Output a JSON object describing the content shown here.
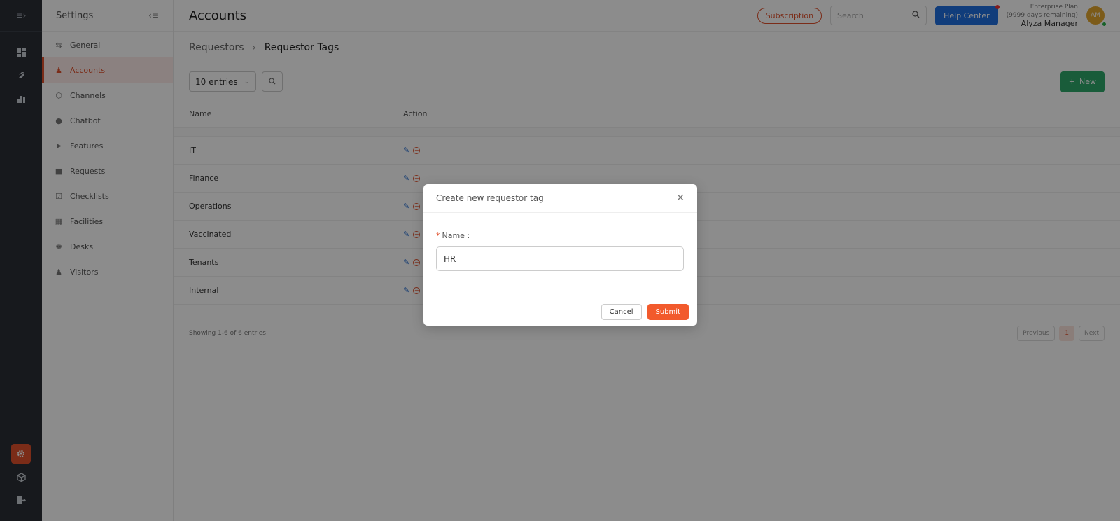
{
  "rail": {
    "icons": [
      "menu-expand-icon",
      "dashboard-icon",
      "rocket-icon",
      "analytics-icon",
      "gear-icon",
      "cube-icon",
      "logout-icon"
    ]
  },
  "sidebar": {
    "title": "Settings",
    "items": [
      {
        "label": "General",
        "icon": "sliders-icon"
      },
      {
        "label": "Accounts",
        "icon": "users-icon",
        "active": true
      },
      {
        "label": "Channels",
        "icon": "cube-icon"
      },
      {
        "label": "Chatbot",
        "icon": "chat-icon"
      },
      {
        "label": "Features",
        "icon": "rocket-icon"
      },
      {
        "label": "Requests",
        "icon": "question-icon"
      },
      {
        "label": "Checklists",
        "icon": "checklist-icon"
      },
      {
        "label": "Facilities",
        "icon": "calendar-icon"
      },
      {
        "label": "Desks",
        "icon": "desk-icon"
      },
      {
        "label": "Visitors",
        "icon": "visitor-icon"
      }
    ]
  },
  "header": {
    "title": "Accounts",
    "subscription_label": "Subscription",
    "search_placeholder": "Search",
    "help_label": "Help Center",
    "plan_name": "Enterprise Plan",
    "plan_remaining": "(9999 days remaining)",
    "user_name": "Alyza Manager",
    "avatar_initials": "AM"
  },
  "breadcrumb": {
    "parent": "Requestors",
    "separator": ">",
    "current": "Requestor Tags"
  },
  "toolbar": {
    "entries_label": "10 entries",
    "new_label": "New"
  },
  "table": {
    "headers": {
      "name": "Name",
      "action": "Action"
    },
    "rows": [
      "IT",
      "Finance",
      "Operations",
      "Vaccinated",
      "Tenants",
      "Internal"
    ]
  },
  "footer": {
    "showing": "Showing 1-6 of 6 entries",
    "previous": "Previous",
    "page": "1",
    "next": "Next"
  },
  "modal": {
    "title": "Create new requestor tag",
    "required_mark": "*",
    "name_label": "Name :",
    "name_value": "HR",
    "cancel_label": "Cancel",
    "submit_label": "Submit"
  },
  "colors": {
    "accent": "#e0502c",
    "help_blue": "#1f6fe0",
    "new_green": "#2ea86b",
    "rail_bg": "#2b2f36"
  }
}
